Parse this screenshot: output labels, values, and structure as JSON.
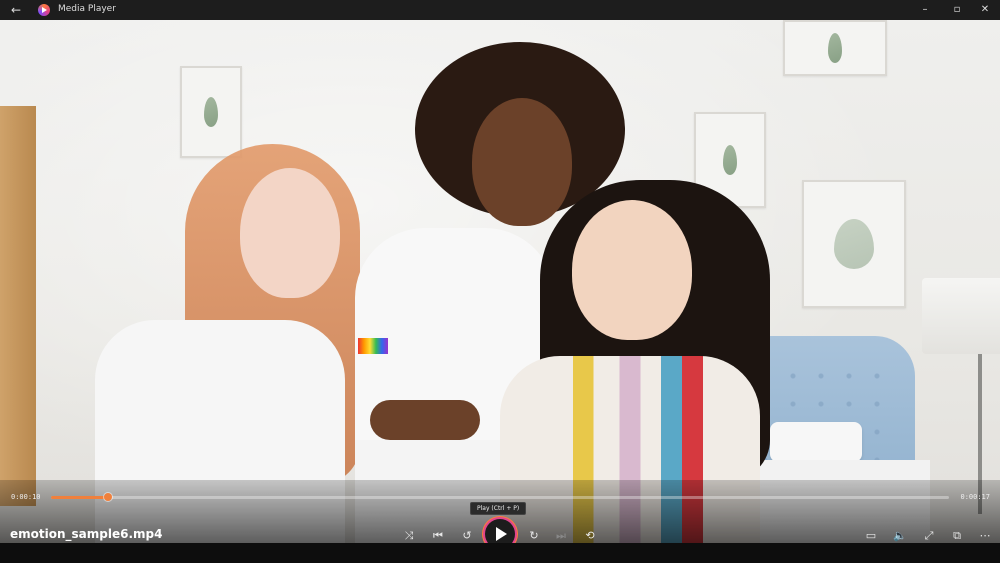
{
  "window": {
    "title": "Media Player",
    "back_icon": "back-arrow-icon",
    "minimize_label": "–",
    "maximize_label": "▫",
    "close_label": "✕"
  },
  "player": {
    "current_time": "0:00:10",
    "total_time": "0:00:17",
    "progress": 0.064,
    "file_name": "emotion_sample6.mp4",
    "tooltip": "Play (Ctrl + P)",
    "accent_color": "#f0803c"
  },
  "controls": {
    "shuffle": {
      "icon": "shuffle-icon",
      "glyph": "⤨"
    },
    "previous": {
      "icon": "previous-icon",
      "glyph": "⏮"
    },
    "rewind": {
      "icon": "skip-back-10-icon",
      "glyph": "↺"
    },
    "play": {
      "icon": "play-icon"
    },
    "forward": {
      "icon": "skip-forward-30-icon",
      "glyph": "↻"
    },
    "next": {
      "icon": "next-icon",
      "glyph": "⏭"
    },
    "repeat": {
      "icon": "repeat-off-icon",
      "glyph": "⟲"
    },
    "captions": {
      "icon": "captions-icon",
      "glyph": "▭"
    },
    "volume": {
      "icon": "volume-icon",
      "glyph": "🔈"
    },
    "fullscreen": {
      "icon": "fullscreen-icon",
      "glyph": "⤢"
    },
    "miniplayer": {
      "icon": "miniplayer-icon",
      "glyph": "⧉"
    },
    "more": {
      "icon": "more-icon",
      "glyph": "⋯"
    }
  }
}
